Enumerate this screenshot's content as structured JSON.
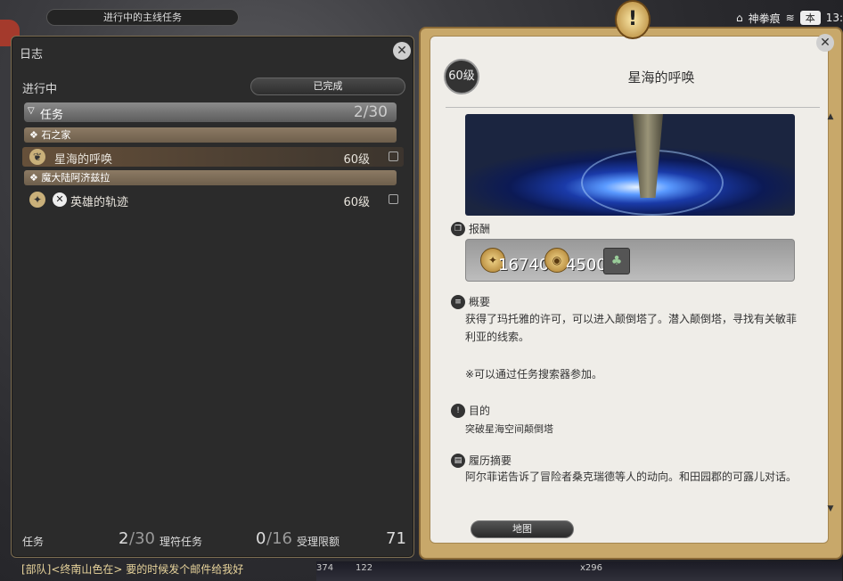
{
  "top_bar": {
    "title": "进行中的主线任务"
  },
  "status": {
    "location": "神拳痕",
    "server_badge": "本",
    "time": "13:"
  },
  "journal": {
    "title": "日志",
    "tab_in_progress": "进行中",
    "tab_completed": "已完成",
    "group": {
      "label": "任务",
      "count": "2/30"
    },
    "categories": [
      {
        "label": "石之家",
        "quests": [
          {
            "name": "星海的呼唤",
            "level": "60级",
            "selected": true
          }
        ]
      },
      {
        "label": "魔大陆阿济兹拉",
        "quests": [
          {
            "name": "英雄的轨迹",
            "level": "60级",
            "selected": false
          }
        ]
      }
    ],
    "footer": {
      "quests_label": "任务",
      "quests_count": "2",
      "quests_max": "/30",
      "levequests_label": "理符任务",
      "levequests_count": "0",
      "levequests_max": "/16",
      "allowance_label": "受理限额",
      "allowance_value": "71"
    }
  },
  "detail": {
    "level_badge": "60级",
    "title": "星海的呼唤",
    "reward_label": "报酬",
    "rewards": {
      "exp": "16740",
      "gil": "4500"
    },
    "summary_label": "概要",
    "summary_text": "获得了玛托雅的许可，可以进入颠倒塔了。潜入颠倒塔，寻找有关敏菲利亚的线索。",
    "summary_note": "※可以通过任务搜索器参加。",
    "objective_label": "目的",
    "objective_text": "突破星海空间颠倒塔",
    "history_label": "履历摘要",
    "history_text": "阿尔菲诺告诉了冒险者桑克瑞德等人的动向。和田园郡的可露儿对话。",
    "map_button": "地图"
  },
  "chat": {
    "line": "[部队]<终南山色在> 要的时候发个邮件给我好"
  },
  "hotbar": {
    "values": [
      "374",
      "122",
      "x296"
    ]
  },
  "icons": [
    "close-icon",
    "exp-icon",
    "gil-icon",
    "item-icon",
    "alert-icon",
    "wifi-icon",
    "home-icon"
  ]
}
